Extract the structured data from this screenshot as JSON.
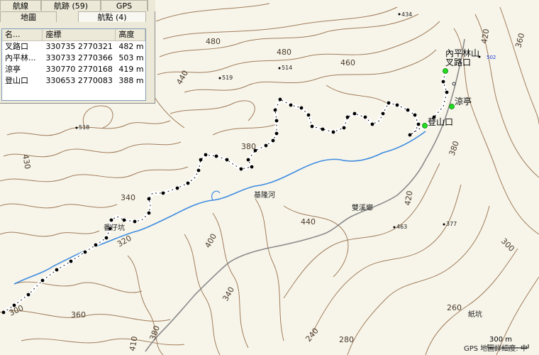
{
  "tabs_row1": [
    {
      "label": "航線",
      "active": false
    },
    {
      "label": "航跡 (59)",
      "active": false
    },
    {
      "label": "GPS",
      "active": false
    }
  ],
  "tabs_row2": [
    {
      "label": "地圖",
      "active": false
    },
    {
      "label": "航點 (4)",
      "active": true
    }
  ],
  "waypoint_table": {
    "headers": [
      "名...",
      "座標",
      "高度"
    ],
    "rows": [
      [
        "叉路口",
        "330735 2770321",
        "482 m"
      ],
      [
        "內平林...",
        "330733 2770366",
        "503 m"
      ],
      [
        "涼亭",
        "330770 2770168",
        "419 m"
      ],
      [
        "登山口",
        "330653 2770083",
        "388 m"
      ]
    ]
  },
  "map": {
    "contour_labels": [
      "480",
      "480",
      "460",
      "440",
      "420",
      "360",
      "430",
      "380",
      "340",
      "320",
      "300",
      "400",
      "340",
      "360",
      "380",
      "410",
      "280",
      "240",
      "260",
      "300",
      "420",
      "440",
      "380"
    ],
    "spot_heights": [
      "434",
      "519",
      "514",
      "518",
      "463",
      "377"
    ],
    "places": [
      "基隆河",
      "雙溪鄉",
      "番仔坑",
      "紙坑"
    ],
    "waypoint_labels": [
      "內平林山",
      "叉路口",
      "涼亭",
      "登山口"
    ],
    "peak_label": "502",
    "scale_label": "300 m",
    "detail_label": "GPS 地圖詳細度: 中",
    "colors": {
      "background": "#f7f5ea",
      "contour": "#a07c5a",
      "river": "#3d8be0",
      "road": "#8a8a8a",
      "track": "#000000",
      "waypoint": "#22dd22"
    }
  }
}
